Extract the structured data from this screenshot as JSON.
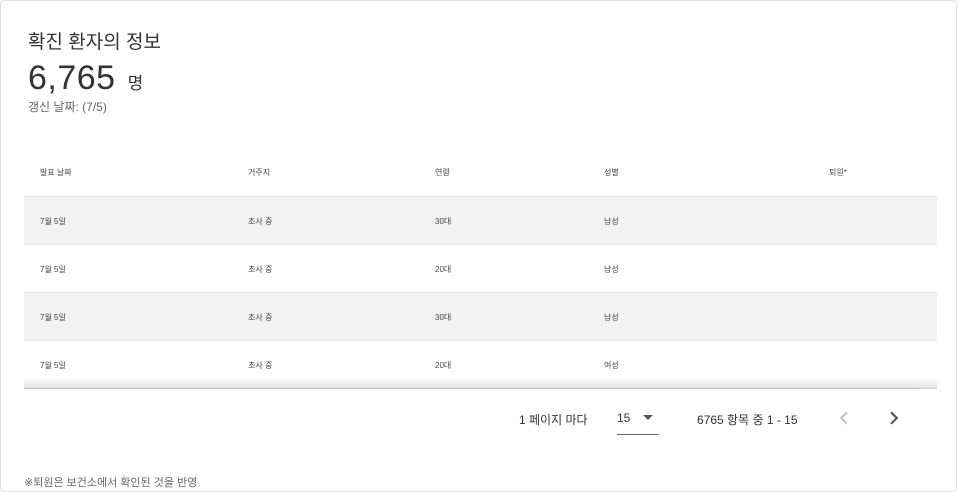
{
  "card": {
    "title": "확진 환자의 정보",
    "count": "6,765",
    "unit": "명",
    "updated": "갱신 날짜: (7/5)"
  },
  "table": {
    "headers": [
      "발표 날짜",
      "거주지",
      "연령",
      "성별",
      "퇴원*"
    ],
    "rows": [
      [
        "7월 5일",
        "조사 중",
        "30대",
        "남성",
        ""
      ],
      [
        "7월 5일",
        "조사 중",
        "20대",
        "남성",
        ""
      ],
      [
        "7월 5일",
        "조사 중",
        "30대",
        "남성",
        ""
      ],
      [
        "7월 5일",
        "조사 중",
        "20대",
        "여성",
        ""
      ]
    ]
  },
  "pagination": {
    "per_page_label": "1 페이지 마다",
    "per_page_value": "15",
    "range_text": "6765 항목 중 1 - 15",
    "prev_icon": "chevron-left-icon",
    "next_icon": "chevron-right-icon"
  },
  "footnote": "※퇴원은 보건소에서 확인된 것을 반영",
  "colors": {
    "row_shade": "#f2f2f2",
    "border": "#e0e0e0",
    "text": "#333333"
  }
}
